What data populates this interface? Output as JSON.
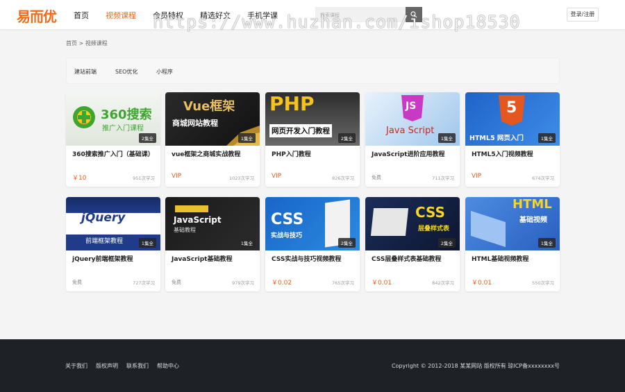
{
  "header": {
    "logo": "易而优",
    "nav": [
      "首页",
      "视频课程",
      "会员特权",
      "精选好文",
      "手机学课"
    ],
    "active_index": 1,
    "search_placeholder": "搜索课程",
    "login_label": "登录/注册",
    "watermark": "https://www.huzhan.com/ishop18530"
  },
  "breadcrumb": "首页 > 视频课程",
  "filters": [
    "建站前端",
    "SEO优化",
    "小程序"
  ],
  "courses": [
    {
      "title": "360搜索推广入门（基础课）",
      "price": "￥10",
      "learners": "951次学习",
      "episodes": "2集全",
      "thumb_line1": "360搜索",
      "thumb_line2": "推广入门课程"
    },
    {
      "title": "vue框架之商城实战教程",
      "price": "VIP",
      "learners": "1023次学习",
      "episodes": "1集全",
      "thumb_line1": "Vue框架",
      "thumb_line2": "商城网站教程"
    },
    {
      "title": "PHP入门教程",
      "price": "VIP",
      "learners": "826次学习",
      "episodes": "2集全",
      "thumb_line1": "PHP",
      "thumb_line2": "网页开发入门教程"
    },
    {
      "title": "JavaScript进阶应用教程",
      "price": "免费",
      "learners": "711次学习",
      "episodes": "1集全",
      "thumb_line1": "JS",
      "thumb_line2": "Java Script"
    },
    {
      "title": "HTML5入门视频教程",
      "price": "VIP",
      "learners": "674次学习",
      "episodes": "1集全",
      "thumb_line1": "5",
      "thumb_line2": "HTML5 网页入门"
    },
    {
      "title": "jQuery前端框架教程",
      "price": "免费",
      "learners": "727次学习",
      "episodes": "1集全",
      "thumb_line1": "jQuery",
      "thumb_line2": "前端框架教程"
    },
    {
      "title": "JavaScript基础教程",
      "price": "免费",
      "learners": "979次学习",
      "episodes": "1集全",
      "thumb_line1": "JavaScript",
      "thumb_line2": "基础教程"
    },
    {
      "title": "CSS实战与技巧视频教程",
      "price": "￥0.02",
      "learners": "765次学习",
      "episodes": "2集全",
      "thumb_line1": "CSS",
      "thumb_line2": "实战与技巧"
    },
    {
      "title": "CSS层叠样式表基础教程",
      "price": "￥0.01",
      "learners": "842次学习",
      "episodes": "2集全",
      "thumb_line1": "CSS",
      "thumb_line2": "层叠样式表"
    },
    {
      "title": "HTML基础视频教程",
      "price": "￥0.01",
      "learners": "550次学习",
      "episodes": "1集全",
      "thumb_line1": "HTML",
      "thumb_line2": "基础视频"
    }
  ],
  "footer": {
    "links": [
      "关于我们",
      "版权声明",
      "联系我们",
      "帮助中心"
    ],
    "copyright": "Copyright © 2012-2018 某某网站 版权所有  琼ICP备xxxxxxxx号"
  },
  "colors": {
    "accent": "#f06a1a",
    "footer_bg": "#1e2126"
  }
}
